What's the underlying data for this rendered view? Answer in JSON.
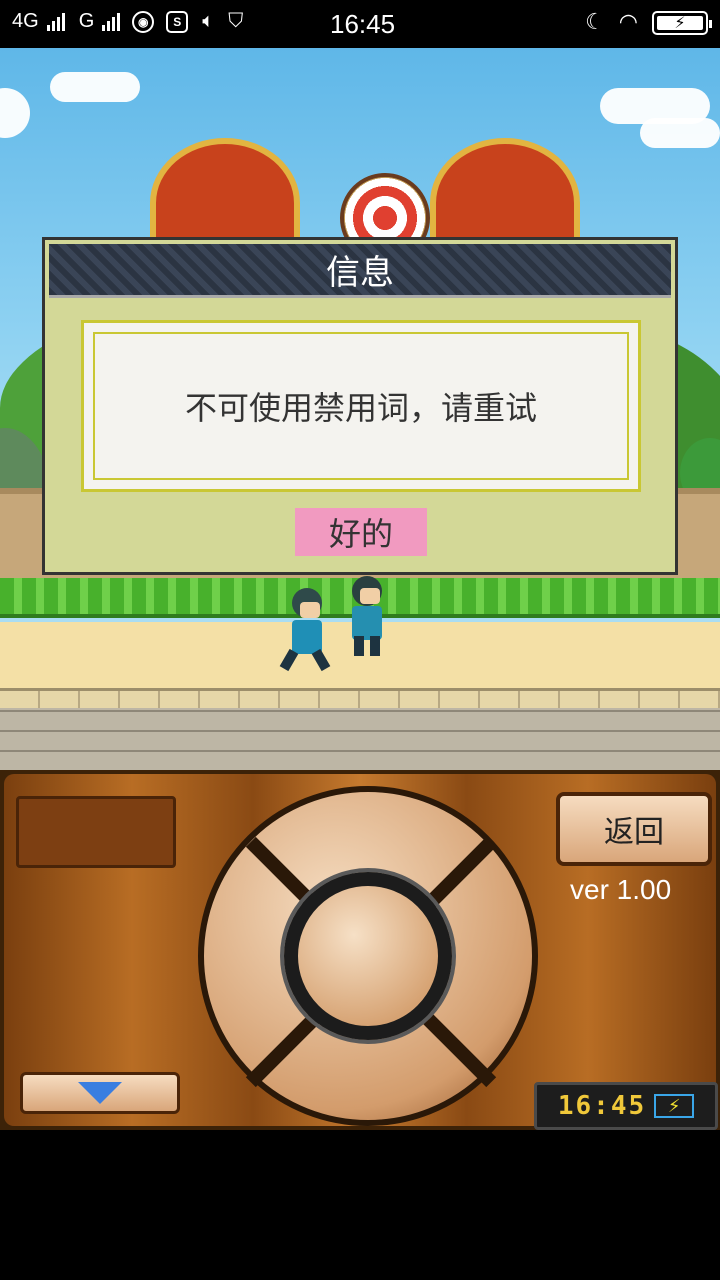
{
  "status_bar": {
    "network_1": "4G",
    "network_2": "G",
    "time": "16:45",
    "icons": [
      "globe-icon",
      "s-icon",
      "volume-icon",
      "shield-icon",
      "moon-icon",
      "wifi-icon",
      "battery-icon"
    ]
  },
  "dialog": {
    "title": "信息",
    "message": "不可使用禁用词，请重试",
    "ok_label": "好的"
  },
  "panel": {
    "back_label": "返回",
    "version": "ver 1.00",
    "clock_time": "16:45"
  },
  "colors": {
    "dialog_bg": "#d3d897",
    "ok_button": "#f19ac0",
    "clock_digits": "#f0c83a"
  }
}
